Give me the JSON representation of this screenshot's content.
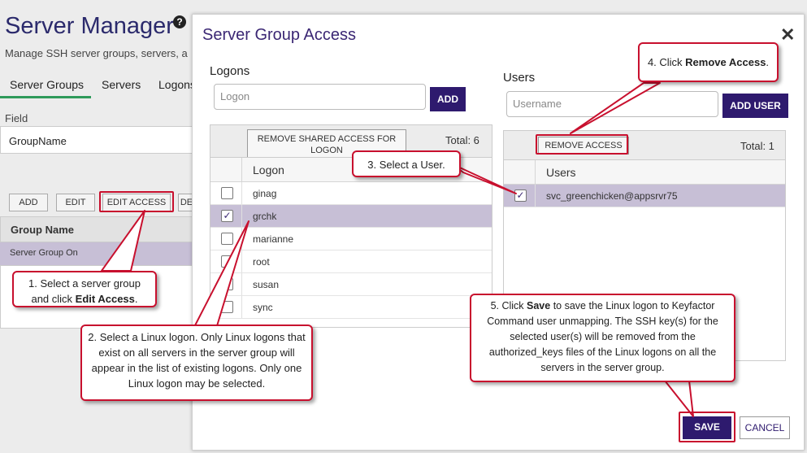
{
  "background": {
    "title": "Server Manager",
    "subtitle": "Manage SSH server groups, servers, a",
    "tabs": [
      {
        "label": "Server Groups",
        "active": true
      },
      {
        "label": "Servers",
        "active": false
      },
      {
        "label": "Logons",
        "active": false
      }
    ],
    "field_label": "Field",
    "field_value": "GroupName",
    "toolbar": {
      "add": "ADD",
      "edit": "EDIT",
      "edit_access": "EDIT ACCESS",
      "delete": "DE"
    },
    "grid_header": "Group Name",
    "grid_row": "Server Group On"
  },
  "modal": {
    "title": "Server Group Access",
    "close_label": "✕",
    "logons": {
      "section_label": "Logons",
      "input_placeholder": "Logon",
      "add_button": "ADD",
      "remove_button": "REMOVE SHARED ACCESS FOR LOGON",
      "total": "Total: 6",
      "column_header": "Logon",
      "rows": [
        {
          "name": "ginag",
          "checked": false
        },
        {
          "name": "grchk",
          "checked": true
        },
        {
          "name": "marianne",
          "checked": false
        },
        {
          "name": "root",
          "checked": false
        },
        {
          "name": "susan",
          "checked": false
        },
        {
          "name": "sync",
          "checked": false
        }
      ]
    },
    "users": {
      "section_label": "Users",
      "input_placeholder": "Username",
      "add_button": "ADD USER",
      "remove_button": "REMOVE ACCESS",
      "total": "Total: 1",
      "column_header": "Users",
      "rows": [
        {
          "name": "svc_greenchicken@appsrvr75",
          "checked": true
        }
      ]
    },
    "save_button": "SAVE",
    "cancel_button": "CANCEL"
  },
  "callouts": {
    "step1": {
      "pre": "1. Select a server group and click ",
      "bold": "Edit Access",
      "post": "."
    },
    "step2": "2. Select a Linux logon. Only Linux logons that exist on all servers in the server group will appear in the list of existing logons. Only one Linux logon may be selected.",
    "step3": "3. Select a User.",
    "step4": {
      "pre": "4. Click ",
      "bold": "Remove Access",
      "post": "."
    },
    "step5": {
      "pre": "5. Click ",
      "bold": "Save",
      "post": " to save the Linux logon to Keyfactor Command user unmapping. The SSH key(s) for the selected user(s) will be removed from the authorized_keys files of the Linux logons on all the servers in the server group."
    }
  },
  "colors": {
    "brand_purple": "#2e1a6e",
    "title_purple": "#3b2774",
    "selected_row": "#c7bfd6",
    "callout_red": "#c8102e",
    "active_tab_green": "#2f9a5a"
  }
}
